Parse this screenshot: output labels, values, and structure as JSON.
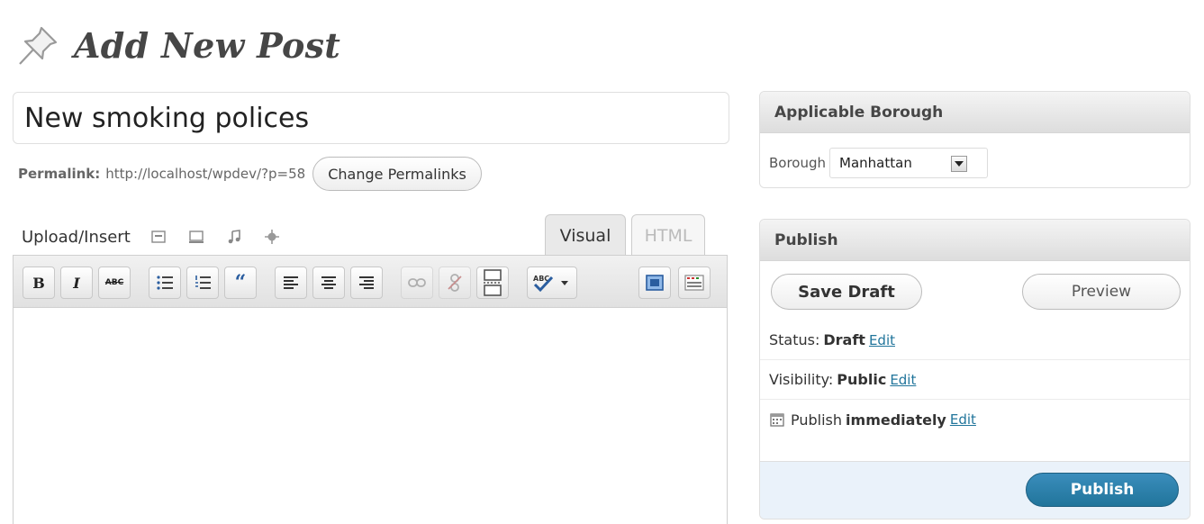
{
  "heading": {
    "title": "Add New Post",
    "icon": "pin-icon"
  },
  "post": {
    "title_value": "New smoking polices",
    "permalink_label": "Permalink:",
    "permalink_url": "http://localhost/wpdev/?p=58",
    "change_permalinks_label": "Change Permalinks"
  },
  "media": {
    "upload_label": "Upload/Insert",
    "icons": [
      "image-icon",
      "video-icon",
      "audio-icon",
      "media-icon"
    ]
  },
  "editor": {
    "tabs": [
      {
        "label": "Visual",
        "active": true
      },
      {
        "label": "HTML",
        "active": false
      }
    ],
    "toolbar": [
      {
        "name": "bold-button",
        "text": "B"
      },
      {
        "name": "italic-button",
        "text": "I"
      },
      {
        "name": "strikethrough-button",
        "text": "ABC"
      },
      {
        "name": "bullet-list-button"
      },
      {
        "name": "numbered-list-button"
      },
      {
        "name": "blockquote-button",
        "text": "“"
      },
      {
        "name": "align-left-button"
      },
      {
        "name": "align-center-button"
      },
      {
        "name": "align-right-button"
      },
      {
        "name": "insert-link-button",
        "disabled": true
      },
      {
        "name": "unlink-button",
        "disabled": true
      },
      {
        "name": "insert-more-button"
      },
      {
        "name": "spellcheck-button"
      },
      {
        "name": "fullscreen-button"
      },
      {
        "name": "kitchen-sink-button"
      }
    ]
  },
  "borough": {
    "header": "Applicable Borough",
    "label": "Borough",
    "selected": "Manhattan"
  },
  "publish": {
    "header": "Publish",
    "save_draft_label": "Save Draft",
    "preview_label": "Preview",
    "status_label": "Status:",
    "status_value": "Draft",
    "visibility_label": "Visibility:",
    "visibility_value": "Public",
    "schedule_label": "Publish",
    "schedule_value": "immediately",
    "edit_label": "Edit",
    "publish_button_label": "Publish"
  },
  "colors": {
    "link": "#21759b",
    "publish_button": "#21759b",
    "publish_footer": "#eaf2fa"
  }
}
